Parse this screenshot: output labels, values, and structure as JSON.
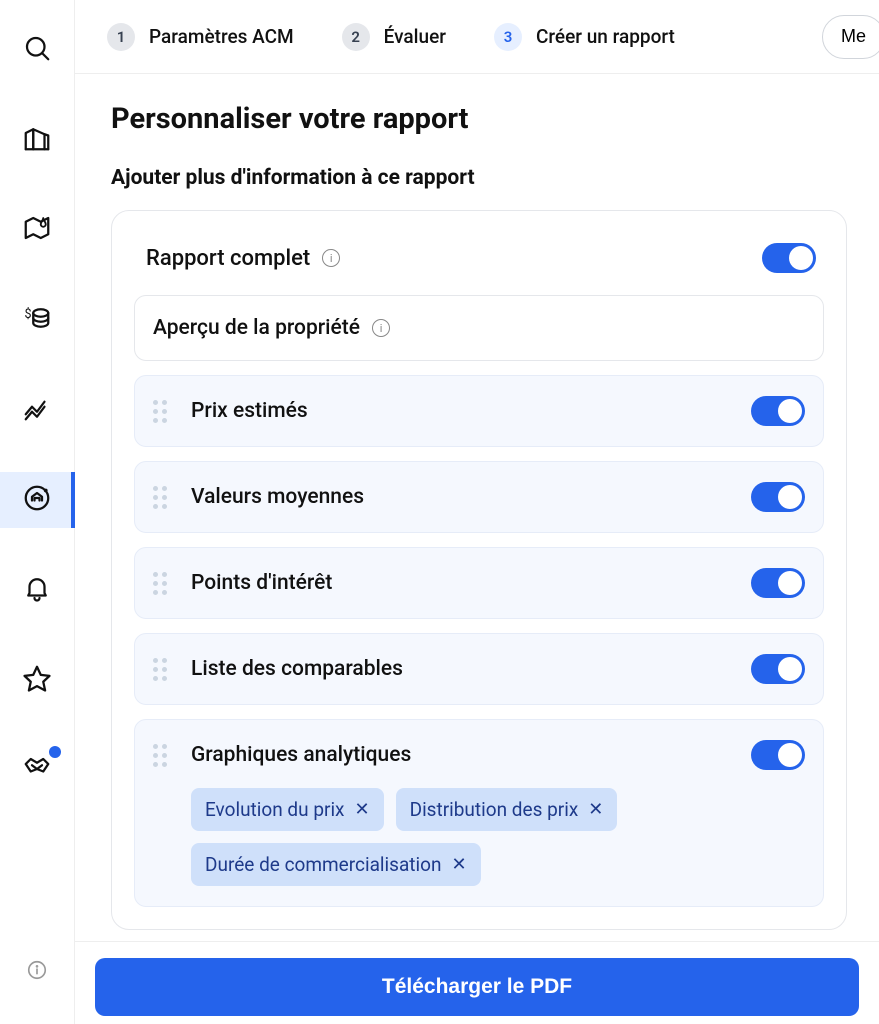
{
  "stepper": {
    "steps": [
      {
        "num": "1",
        "label": "Paramètres ACM"
      },
      {
        "num": "2",
        "label": "Évaluer"
      },
      {
        "num": "3",
        "label": "Créer un rapport"
      }
    ],
    "menu_label": "Me"
  },
  "page": {
    "title": "Personnaliser votre rapport",
    "subtitle": "Ajouter plus d'information à ce rapport"
  },
  "report": {
    "full_report_label": "Rapport complet",
    "overview_label": "Aperçu de la propriété",
    "options": {
      "estimated_prices": "Prix estimés",
      "avg_values": "Valeurs moyennes",
      "points_of_interest": "Points d'intérêt",
      "comparables_list": "Liste des comparables",
      "analytical_charts": "Graphiques analytiques"
    },
    "chips": [
      "Evolution du prix",
      "Distribution des prix",
      "Durée de commercialisation"
    ]
  },
  "footer": {
    "download_label": "Télécharger le PDF"
  }
}
